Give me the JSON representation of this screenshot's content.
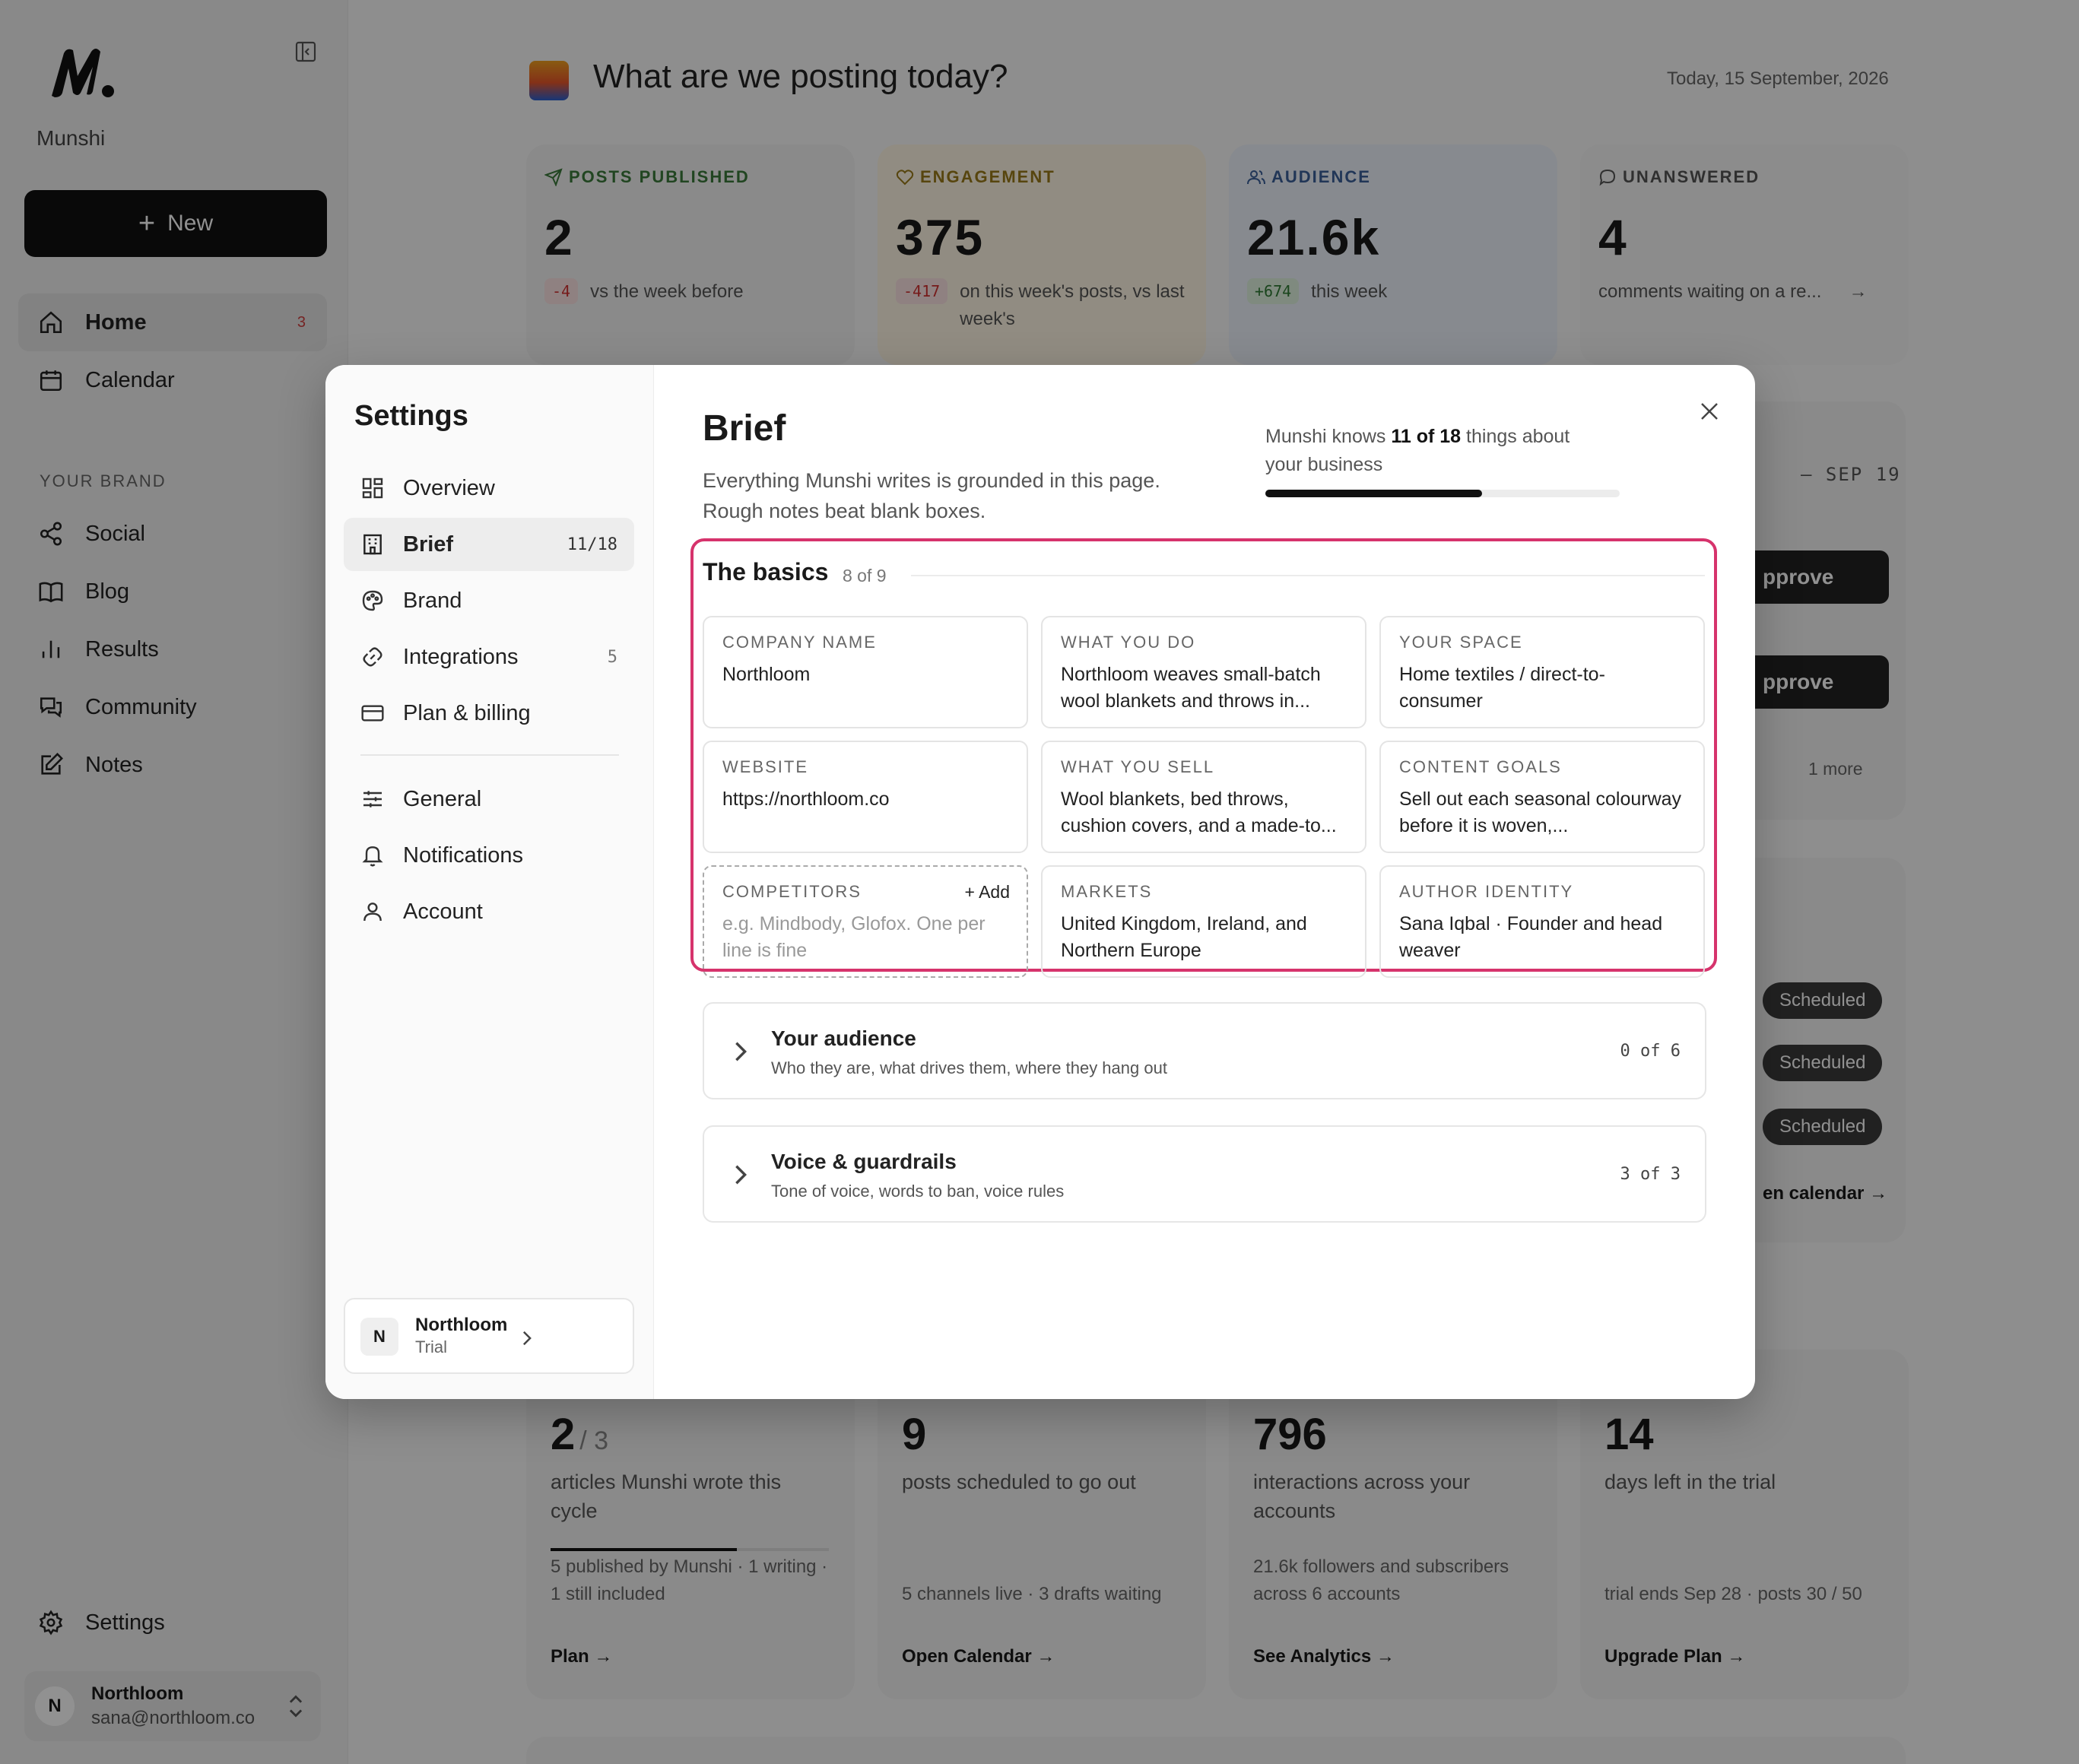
{
  "app": {
    "name": "Munshi"
  },
  "sidebar": {
    "new_label": "New",
    "nav": [
      {
        "label": "Home",
        "badge": "3"
      },
      {
        "label": "Calendar"
      }
    ],
    "brand_section": "YOUR BRAND",
    "brand_items": [
      {
        "label": "Social"
      },
      {
        "label": "Blog"
      },
      {
        "label": "Results"
      },
      {
        "label": "Community"
      },
      {
        "label": "Notes"
      }
    ],
    "settings_label": "Settings",
    "user": {
      "initial": "N",
      "name": "Northloom",
      "email": "sana@northloom.co"
    }
  },
  "header": {
    "title": "What are we posting today?",
    "date": "Today, 15 September, 2026"
  },
  "stats": [
    {
      "label": "POSTS PUBLISHED",
      "value": "2",
      "delta": "-4",
      "note": "vs the week before",
      "color": "#3a7a3a"
    },
    {
      "label": "ENGAGEMENT",
      "value": "375",
      "delta": "-417",
      "note": "on this week's posts, vs last week's",
      "color": "#9a7a1a"
    },
    {
      "label": "AUDIENCE",
      "value": "21.6k",
      "delta": "+674",
      "note": "this week",
      "color": "#3a5f9a"
    },
    {
      "label": "UNANSWERED",
      "value": "4",
      "note": "comments waiting on a re...",
      "color": "#555555"
    }
  ],
  "background_panel": {
    "date_range": "– SEP 19",
    "approve_label": "pprove",
    "more_label": "1 more",
    "scheduled_label": "Scheduled",
    "calendar_link": "en calendar →"
  },
  "bottom_cards": [
    {
      "value": "2",
      "suffix": "/ 3",
      "title": "articles Munshi wrote this cycle",
      "progress": 0.67,
      "footer": "5 published by Munshi · 1 writing · 1 still included",
      "link": "Plan →"
    },
    {
      "value": "9",
      "title": "posts scheduled to go out",
      "footer": "5 channels live · 3 drafts waiting",
      "link": "Open Calendar →"
    },
    {
      "value": "796",
      "title": "interactions across your accounts",
      "footer": "21.6k followers and subscribers across 6 accounts",
      "link": "See Analytics →"
    },
    {
      "value": "14",
      "title": "days left in the trial",
      "footer": "trial ends Sep 28 · posts 30 / 50",
      "link": "Upgrade Plan →"
    }
  ],
  "modal": {
    "title": "Settings",
    "nav": [
      {
        "label": "Overview"
      },
      {
        "label": "Brief",
        "count": "11/18"
      },
      {
        "label": "Brand"
      },
      {
        "label": "Integrations",
        "count": "5"
      },
      {
        "label": "Plan & billing"
      }
    ],
    "nav2": [
      {
        "label": "General"
      },
      {
        "label": "Notifications"
      },
      {
        "label": "Account"
      }
    ],
    "workspace": {
      "initial": "N",
      "name": "Northloom",
      "plan": "Trial"
    },
    "brief": {
      "title": "Brief",
      "description_1": "Everything Munshi writes is grounded in this page.",
      "description_2": "Rough notes beat blank boxes.",
      "knows_prefix": "Munshi knows ",
      "knows_count": "11 of 18",
      "knows_suffix": " things about",
      "knows_line2": "your business",
      "progress": 0.611
    },
    "basics": {
      "title": "The basics",
      "count": "8 of 9",
      "add_label": "+ Add",
      "fields": [
        {
          "label": "COMPANY NAME",
          "value": "Northloom"
        },
        {
          "label": "WHAT YOU DO",
          "value": "Northloom weaves small-batch wool blankets and throws in..."
        },
        {
          "label": "YOUR SPACE",
          "value": "Home textiles / direct-to-consumer"
        },
        {
          "label": "WEBSITE",
          "value": "https://northloom.co"
        },
        {
          "label": "WHAT YOU SELL",
          "value": "Wool blankets, bed throws, cushion covers, and a made-to..."
        },
        {
          "label": "CONTENT GOALS",
          "value": "Sell out each seasonal colourway before it is woven,..."
        },
        {
          "label": "COMPETITORS",
          "placeholder": "e.g. Mindbody, Glofox. One per line is fine"
        },
        {
          "label": "MARKETS",
          "value": "United Kingdom, Ireland, and Northern Europe"
        },
        {
          "label": "AUTHOR IDENTITY",
          "value": "Sana Iqbal · Founder and head weaver"
        }
      ]
    },
    "sections": [
      {
        "title": "Your audience",
        "subtitle": "Who they are, what drives them, where they hang out",
        "count": "0 of 6"
      },
      {
        "title": "Voice & guardrails",
        "subtitle": "Tone of voice, words to ban, voice rules",
        "count": "3 of 3"
      }
    ]
  },
  "colors": {
    "accent_highlight": "#d6336c",
    "primary": "#111111"
  }
}
